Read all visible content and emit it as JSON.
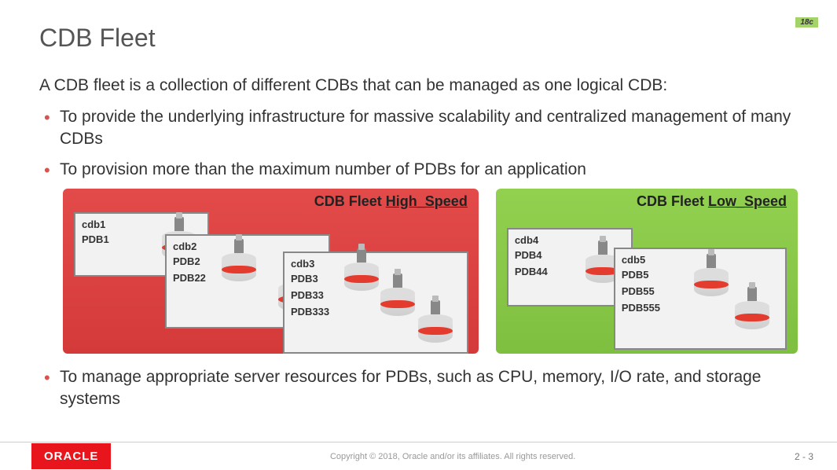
{
  "badge": "18c",
  "title": "CDB Fleet",
  "intro": "A CDB fleet is a collection of different CDBs that can be managed as one logical CDB:",
  "bullets": [
    "To provide the underlying infrastructure for massive scalability and centralized management of many CDBs",
    "To provision more than the maximum number of PDBs for an application"
  ],
  "bullets_after": [
    "To manage appropriate server resources for PDBs, such as CPU, memory, I/O rate, and storage systems"
  ],
  "fleets": {
    "high": {
      "label_prefix": "CDB Fleet ",
      "label_name": "High_Speed",
      "cdbs": [
        {
          "name": "cdb1",
          "pdbs": [
            "PDB1"
          ]
        },
        {
          "name": "cdb2",
          "pdbs": [
            "PDB2",
            "PDB22"
          ]
        },
        {
          "name": "cdb3",
          "pdbs": [
            "PDB3",
            "PDB33",
            "PDB333"
          ]
        }
      ]
    },
    "low": {
      "label_prefix": "CDB Fleet ",
      "label_name": "Low_Speed",
      "cdbs": [
        {
          "name": "cdb4",
          "pdbs": [
            "PDB4",
            "PDB44"
          ]
        },
        {
          "name": "cdb5",
          "pdbs": [
            "PDB5",
            "PDB55",
            "PDB555"
          ]
        }
      ]
    }
  },
  "footer": {
    "brand": "ORACLE",
    "copyright": "Copyright © 2018, Oracle and/or its affiliates. All rights reserved.",
    "page": "2 - 3"
  }
}
